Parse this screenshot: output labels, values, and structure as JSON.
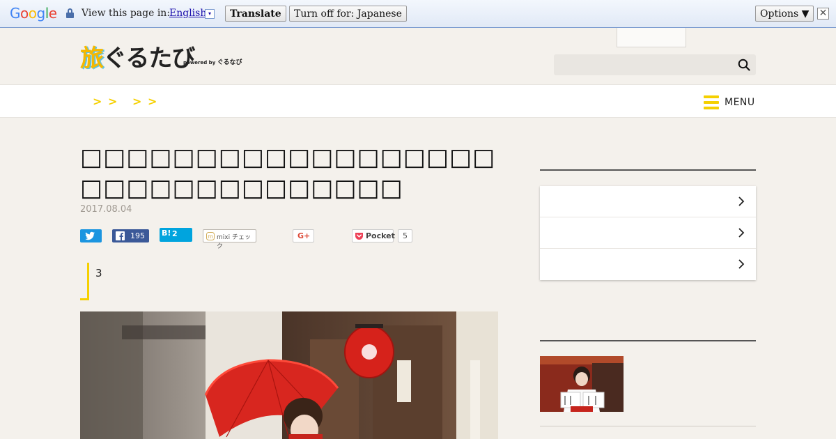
{
  "translate_bar": {
    "logo": {
      "g1": "G",
      "g2": "o",
      "g3": "o",
      "g4": "g",
      "g5": "l",
      "g6": "e"
    },
    "view_label": "View this page in:",
    "language": "English",
    "language_caret": "▾",
    "translate_button": "Translate",
    "turn_off_button": "Turn off for: Japanese",
    "options_button": "Options ▼",
    "close": "✕"
  },
  "header": {
    "logo_text_a": "旅",
    "logo_text_b": "ぐるたび",
    "logo_powered": "powered by",
    "logo_powered_brand": "ぐるなび",
    "search_placeholder": ""
  },
  "nav": {
    "crumbs": [
      ">",
      ">",
      ">",
      ">"
    ],
    "menu_label": "MENU"
  },
  "article": {
    "title": "□□□□□□□□□□□□□□□□□□□□□□□□□□□□□□□□",
    "date": "2017.08.04",
    "share": {
      "facebook_count": "195",
      "hatena_mark": "B!",
      "hatena_count": "2",
      "mixi_label": "mixi チェック",
      "google_plus": "G+",
      "pocket_label": "Pocket",
      "pocket_count": "5"
    },
    "quote_number": "3"
  },
  "colors": {
    "accent_yellow": "#f5d000",
    "twitter": "#1b95e0",
    "facebook": "#3b5998",
    "hatena": "#00a4de",
    "pocket": "#ee4056"
  }
}
